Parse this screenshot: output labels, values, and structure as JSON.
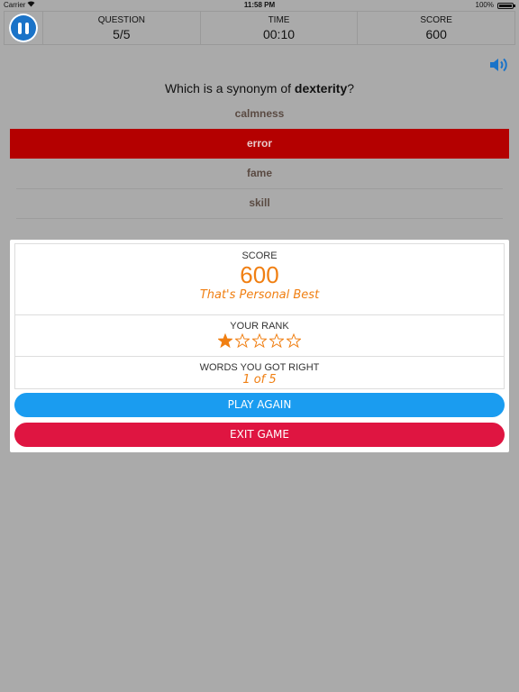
{
  "status_bar": {
    "carrier": "Carrier",
    "time": "11:58 PM",
    "battery": "100%"
  },
  "header": {
    "question_label": "QUESTION",
    "question_value": "5/5",
    "time_label": "TIME",
    "time_value": "00:10",
    "score_label": "SCORE",
    "score_value": "600"
  },
  "question": {
    "prefix": "Which is a synonym of ",
    "word": "dexterity",
    "suffix": "?"
  },
  "answers": [
    {
      "label": "calmness",
      "state": "normal"
    },
    {
      "label": "error",
      "state": "wrong"
    },
    {
      "label": "fame",
      "state": "normal"
    },
    {
      "label": "skill",
      "state": "normal"
    }
  ],
  "result": {
    "score_label": "SCORE",
    "score_value": "600",
    "score_note": "That's Personal Best",
    "rank_label": "YOUR RANK",
    "rank_stars_filled": 1,
    "rank_stars_total": 5,
    "words_label": "WORDS YOU GOT RIGHT",
    "words_value": "1 of 5"
  },
  "buttons": {
    "play_again": "PLAY AGAIN",
    "exit_game": "EXIT GAME"
  },
  "colors": {
    "background": "#aaaaaa",
    "accent_orange": "#f07f12",
    "wrong_answer": "#b40000",
    "play_button": "#1a9cf0",
    "exit_button": "#df1541",
    "pause_button": "#1a73c8"
  }
}
